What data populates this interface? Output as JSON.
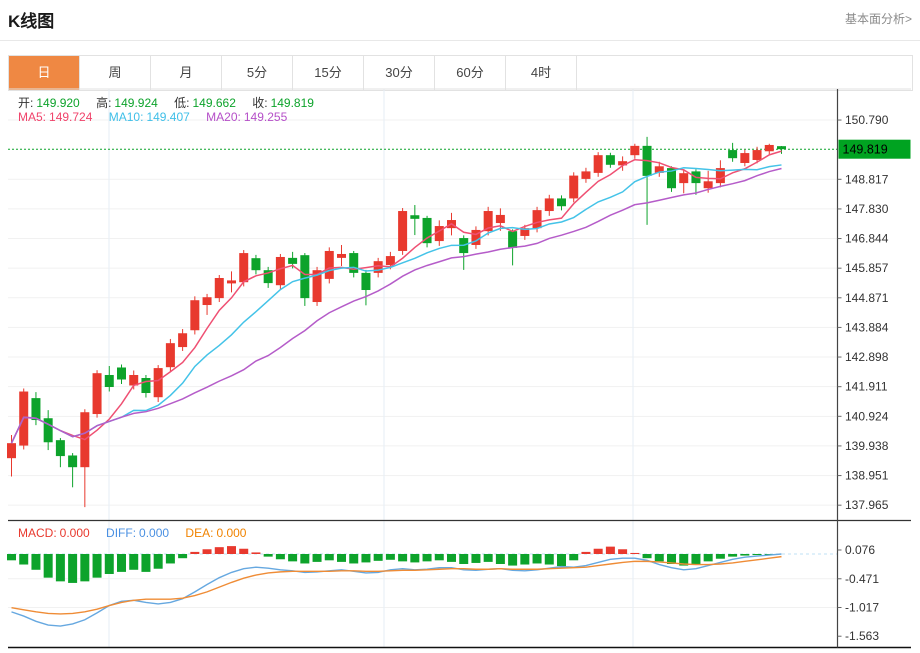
{
  "header": {
    "title": "K线图",
    "link": "基本面分析>"
  },
  "tabs": {
    "items": [
      "日",
      "周",
      "月",
      "5分",
      "15分",
      "30分",
      "60分",
      "4时"
    ],
    "active_index": 0
  },
  "ohlc": {
    "open_label": "开:",
    "open": "149.920",
    "high_label": "高:",
    "high": "149.924",
    "low_label": "低:",
    "low": "149.662",
    "close_label": "收:",
    "close": "149.819"
  },
  "ma": {
    "ma5_label": "MA5:",
    "ma5": "149.724",
    "ma10_label": "MA10:",
    "ma10": "149.407",
    "ma20_label": "MA20:",
    "ma20": "149.255"
  },
  "macd_header": {
    "macd_label": "MACD:",
    "macd": "0.000",
    "diff_label": "DIFF:",
    "diff": "0.000",
    "dea_label": "DEA:",
    "dea": "0.000"
  },
  "colors": {
    "up": "#e8392e",
    "down": "#0da32b",
    "ma5": "#ef5073",
    "ma10": "#44c3e8",
    "ma20": "#b55cc9",
    "diff_line": "#66a8e0",
    "dea_line": "#ef8c36",
    "current_price_bg": "#00a321",
    "current_price_text": "#000000",
    "dotted_line": "#0da32b",
    "tab_active": "#ef8843",
    "grid_h": "#f1f1f1",
    "grid_v": "#e6eef6",
    "axis": "#444444"
  },
  "chart_data": {
    "type": "candlestick",
    "title": "K线图 日线 (daily K-line with MA5/MA10/MA20 and MACD)",
    "current_price": "149.819",
    "price_axis_ticks": [
      "150.790",
      "148.817",
      "147.830",
      "146.844",
      "145.857",
      "144.871",
      "143.884",
      "142.898",
      "141.911",
      "140.924",
      "139.938",
      "138.951",
      "137.965"
    ],
    "price_ylim": [
      137.47,
      151.82
    ],
    "macd_axis_ticks": [
      "0.076",
      "-0.471",
      "-1.017",
      "-1.563"
    ],
    "macd_ylim": [
      -1.77,
      0.54
    ],
    "ohlc": {
      "open": [
        139.53,
        139.95,
        141.53,
        140.86,
        140.13,
        139.62,
        139.23,
        141.0,
        142.3,
        142.55,
        141.95,
        142.2,
        141.56,
        142.56,
        143.23,
        143.79,
        144.63,
        144.86,
        145.35,
        145.39,
        146.19,
        145.79,
        145.29,
        146.2,
        146.29,
        144.73,
        145.5,
        146.2,
        146.36,
        145.7,
        145.7,
        145.96,
        146.43,
        147.62,
        147.53,
        146.76,
        147.19,
        146.86,
        146.63,
        147.09,
        147.36,
        147.09,
        146.93,
        147.19,
        147.76,
        148.18,
        148.18,
        148.83,
        149.03,
        149.62,
        149.28,
        149.62,
        149.93,
        149.03,
        149.19,
        148.69,
        149.08,
        148.52,
        148.69,
        149.79,
        149.36,
        149.46,
        149.75,
        149.92
      ],
      "high": [
        140.3,
        141.85,
        141.73,
        141.13,
        140.2,
        139.7,
        141.16,
        142.46,
        142.6,
        142.65,
        142.45,
        142.3,
        142.63,
        143.5,
        143.83,
        144.92,
        145.0,
        145.63,
        145.75,
        146.46,
        146.3,
        145.9,
        146.33,
        146.4,
        146.36,
        145.9,
        146.55,
        146.63,
        146.43,
        145.8,
        146.2,
        146.4,
        147.86,
        147.96,
        147.6,
        147.45,
        147.7,
        146.95,
        147.25,
        147.9,
        147.85,
        147.15,
        147.3,
        147.9,
        148.3,
        148.28,
        149.05,
        149.2,
        149.72,
        149.7,
        149.58,
        150.0,
        150.23,
        149.4,
        149.25,
        149.15,
        149.15,
        149.1,
        149.45,
        150.03,
        149.8,
        149.9,
        150.0,
        149.924
      ],
      "low": [
        138.92,
        139.82,
        140.63,
        139.8,
        139.23,
        138.56,
        137.9,
        140.88,
        141.75,
        142.0,
        141.82,
        141.55,
        141.4,
        142.4,
        143.1,
        143.65,
        144.3,
        144.73,
        145.05,
        145.25,
        145.65,
        145.2,
        145.15,
        145.85,
        144.6,
        144.6,
        145.35,
        145.93,
        145.55,
        144.62,
        145.55,
        145.82,
        146.3,
        146.96,
        146.55,
        146.6,
        146.95,
        145.8,
        146.5,
        146.95,
        147.1,
        145.95,
        146.8,
        147.05,
        147.6,
        147.78,
        148.05,
        148.7,
        148.9,
        149.2,
        149.1,
        149.5,
        147.3,
        148.9,
        148.4,
        148.35,
        148.3,
        148.37,
        148.55,
        149.4,
        149.25,
        149.35,
        149.65,
        149.662
      ],
      "close": [
        140.03,
        141.75,
        140.8,
        140.06,
        139.6,
        139.23,
        141.06,
        142.36,
        141.9,
        142.15,
        142.3,
        141.7,
        142.53,
        143.36,
        143.69,
        144.79,
        144.89,
        145.53,
        145.45,
        146.36,
        145.79,
        145.36,
        146.23,
        146.0,
        144.86,
        145.79,
        146.43,
        146.33,
        145.7,
        145.13,
        146.09,
        146.26,
        147.76,
        147.5,
        146.69,
        147.26,
        147.46,
        146.36,
        147.13,
        147.76,
        147.63,
        146.53,
        147.19,
        147.79,
        148.18,
        147.92,
        148.94,
        149.08,
        149.62,
        149.3,
        149.42,
        149.93,
        148.93,
        149.25,
        148.52,
        149.02,
        148.69,
        148.75,
        149.19,
        149.52,
        149.69,
        149.79,
        149.96,
        149.819
      ]
    },
    "ma_periods": {
      "ma5": 5,
      "ma10": 10,
      "ma20": 20
    },
    "macd": {
      "hist": [
        -0.12,
        -0.2,
        -0.3,
        -0.45,
        -0.52,
        -0.55,
        -0.52,
        -0.45,
        -0.38,
        -0.34,
        -0.3,
        -0.34,
        -0.28,
        -0.18,
        -0.08,
        0.04,
        0.09,
        0.13,
        0.15,
        0.1,
        0.03,
        -0.05,
        -0.1,
        -0.14,
        -0.18,
        -0.15,
        -0.12,
        -0.15,
        -0.18,
        -0.16,
        -0.13,
        -0.11,
        -0.14,
        -0.16,
        -0.14,
        -0.12,
        -0.15,
        -0.19,
        -0.17,
        -0.15,
        -0.19,
        -0.22,
        -0.2,
        -0.18,
        -0.2,
        -0.23,
        -0.12,
        0.04,
        0.1,
        0.14,
        0.09,
        0.02,
        -0.08,
        -0.14,
        -0.19,
        -0.22,
        -0.19,
        -0.14,
        -0.09,
        -0.05,
        -0.03,
        -0.02,
        -0.01,
        0.0
      ],
      "diff": [
        -1.1,
        -1.18,
        -1.28,
        -1.35,
        -1.37,
        -1.33,
        -1.25,
        -1.12,
        -0.98,
        -0.9,
        -0.88,
        -0.92,
        -0.95,
        -0.92,
        -0.85,
        -0.72,
        -0.58,
        -0.45,
        -0.35,
        -0.28,
        -0.25,
        -0.27,
        -0.3,
        -0.32,
        -0.35,
        -0.34,
        -0.32,
        -0.3,
        -0.33,
        -0.36,
        -0.35,
        -0.3,
        -0.28,
        -0.3,
        -0.29,
        -0.26,
        -0.26,
        -0.3,
        -0.31,
        -0.29,
        -0.28,
        -0.31,
        -0.32,
        -0.3,
        -0.27,
        -0.24,
        -0.25,
        -0.22,
        -0.16,
        -0.1,
        -0.08,
        -0.08,
        -0.12,
        -0.2,
        -0.26,
        -0.3,
        -0.28,
        -0.22,
        -0.16,
        -0.1,
        -0.06,
        -0.04,
        -0.02,
        0.0
      ],
      "dea": [
        -1.02,
        -1.06,
        -1.1,
        -1.13,
        -1.14,
        -1.13,
        -1.1,
        -1.05,
        -0.98,
        -0.92,
        -0.88,
        -0.86,
        -0.86,
        -0.86,
        -0.84,
        -0.79,
        -0.72,
        -0.63,
        -0.54,
        -0.46,
        -0.4,
        -0.36,
        -0.34,
        -0.33,
        -0.33,
        -0.33,
        -0.33,
        -0.32,
        -0.32,
        -0.33,
        -0.33,
        -0.32,
        -0.31,
        -0.31,
        -0.3,
        -0.29,
        -0.28,
        -0.28,
        -0.29,
        -0.29,
        -0.28,
        -0.29,
        -0.29,
        -0.29,
        -0.28,
        -0.27,
        -0.26,
        -0.25,
        -0.22,
        -0.19,
        -0.16,
        -0.14,
        -0.14,
        -0.15,
        -0.17,
        -0.19,
        -0.2,
        -0.2,
        -0.19,
        -0.17,
        -0.14,
        -0.11,
        -0.08,
        -0.05
      ]
    }
  }
}
